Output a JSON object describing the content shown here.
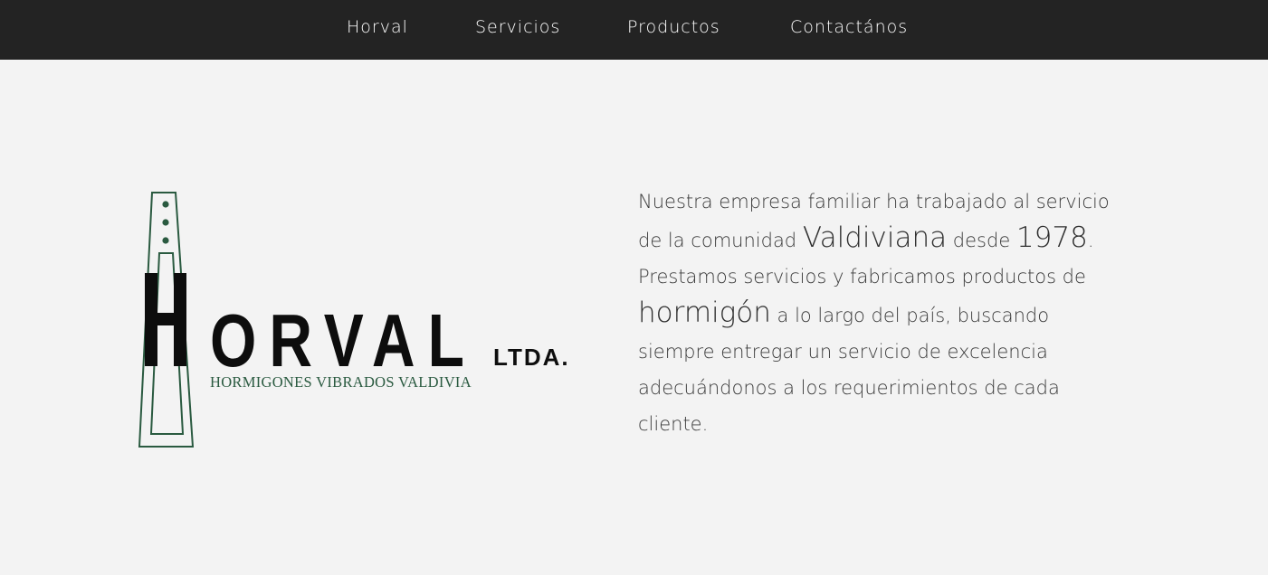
{
  "nav": {
    "items": [
      {
        "label": "Horval"
      },
      {
        "label": "Servicios"
      },
      {
        "label": "Productos"
      },
      {
        "label": "Contactános"
      }
    ]
  },
  "logo": {
    "wordmark": "ORVAL",
    "wordmark_initial": "H",
    "suffix": "LTDA.",
    "tagline": "HORMIGONES VIBRADOS VALDIVIA",
    "accent_color": "#2a5a40"
  },
  "about": {
    "part1": "Nuestra empresa familiar ha trabajado al servicio de la comunidad ",
    "emph1": "Valdiviana",
    "part2": " desde ",
    "emph2": "1978",
    "part3": ". Prestamos servicios y fabricamos productos de ",
    "emph3": "hormigón",
    "part4": " a lo largo del país, buscando siempre entregar un servicio de excelencia adecuándonos a los requerimientos de cada cliente."
  },
  "colors": {
    "navbar": "#232323",
    "background": "#f3f3f3",
    "text": "#3b3b3b"
  }
}
